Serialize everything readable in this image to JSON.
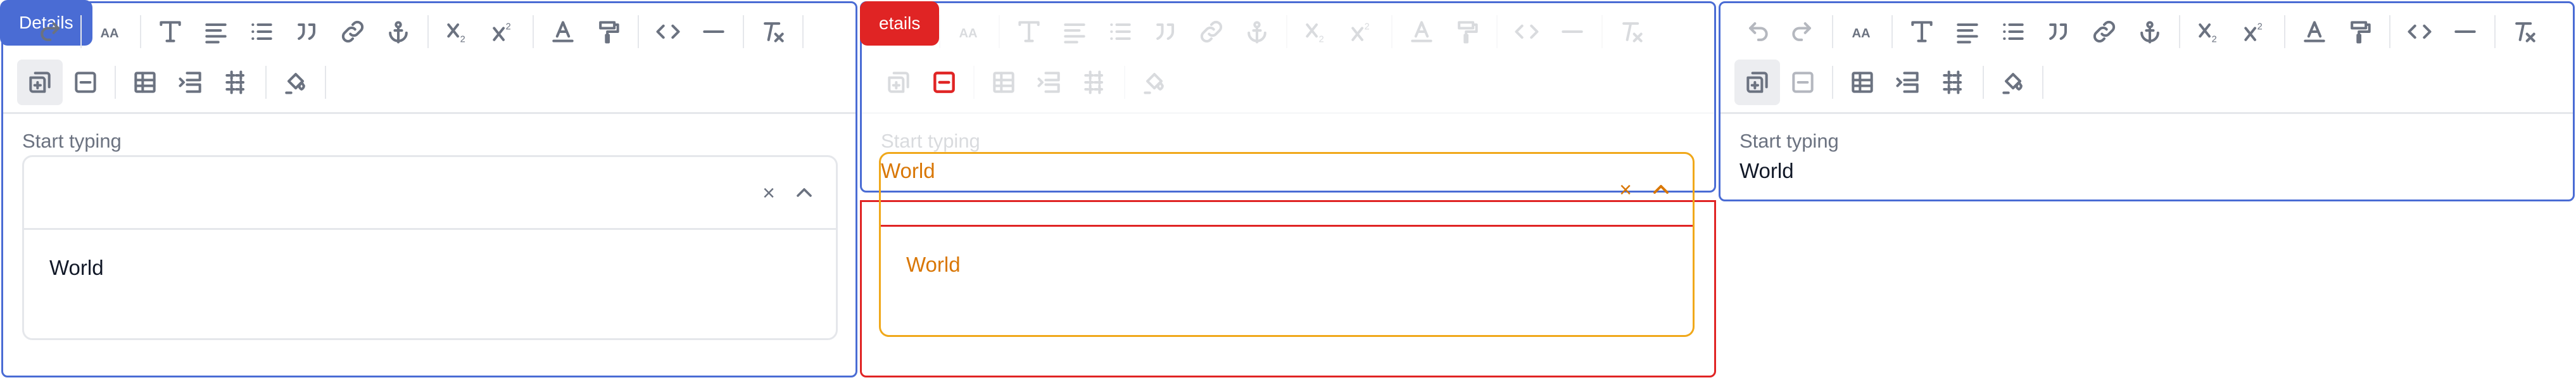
{
  "tooltips": {
    "details_label_1": "Details",
    "details_label_2": "etails"
  },
  "editor": {
    "field_label": "Start typing",
    "field_value": "World"
  },
  "select": {
    "option": "World",
    "clear_glyph": "×",
    "value_panel2": "World"
  },
  "colors": {
    "accent": "#4a6cd4",
    "error": "#e02424",
    "warning": "#d97706"
  }
}
